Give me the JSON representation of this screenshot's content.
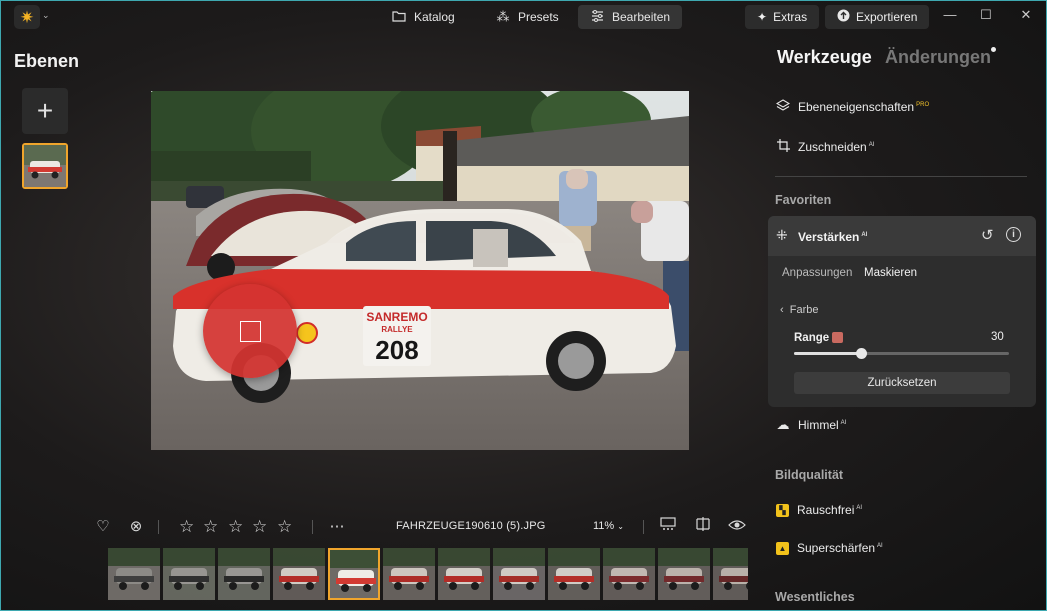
{
  "titlebar": {
    "nav": [
      {
        "label": "Katalog"
      },
      {
        "label": "Presets"
      },
      {
        "label": "Bearbeiten"
      }
    ],
    "extras_label": "Extras",
    "export_label": "Exportieren"
  },
  "layers": {
    "title": "Ebenen",
    "add_label": "+"
  },
  "photo": {
    "plate_top": "SANREMO",
    "plate_mid": "RALLYE",
    "plate_num": "208"
  },
  "toolbar": {
    "filename": "FAHRZEUGE190610 (5).JPG",
    "zoom": "11%",
    "rating": 0
  },
  "filmstrip": {
    "selected_index": 4,
    "count": 12
  },
  "panel": {
    "tab_tools": "Werkzeuge",
    "tab_changes": "Änderungen",
    "layer_props": {
      "label": "Ebeneneigenschaften",
      "tag": "PRO"
    },
    "crop": {
      "label": "Zuschneiden",
      "tag": "AI"
    },
    "favorites_heading": "Favoriten",
    "enhance": {
      "label": "Verstärken",
      "tag": "AI",
      "subtab_adjust": "Anpassungen",
      "subtab_mask": "Maskieren",
      "back_label": "Farbe",
      "range_label": "Range",
      "range_value": "30",
      "range_fraction": 0.31,
      "reset_label": "Zurücksetzen",
      "swatch_color": "#c96a60"
    },
    "sky": {
      "label": "Himmel",
      "tag": "AI"
    },
    "quality_heading": "Bildqualität",
    "denoise": {
      "label": "Rauschfrei",
      "tag": "AI"
    },
    "sharpen": {
      "label": "Superschärfen",
      "tag": "AI"
    },
    "essentials_heading": "Wesentliches"
  },
  "colors": {
    "accent": "#f0a52c",
    "mask": "#d43430",
    "brand": "#f5b324"
  }
}
